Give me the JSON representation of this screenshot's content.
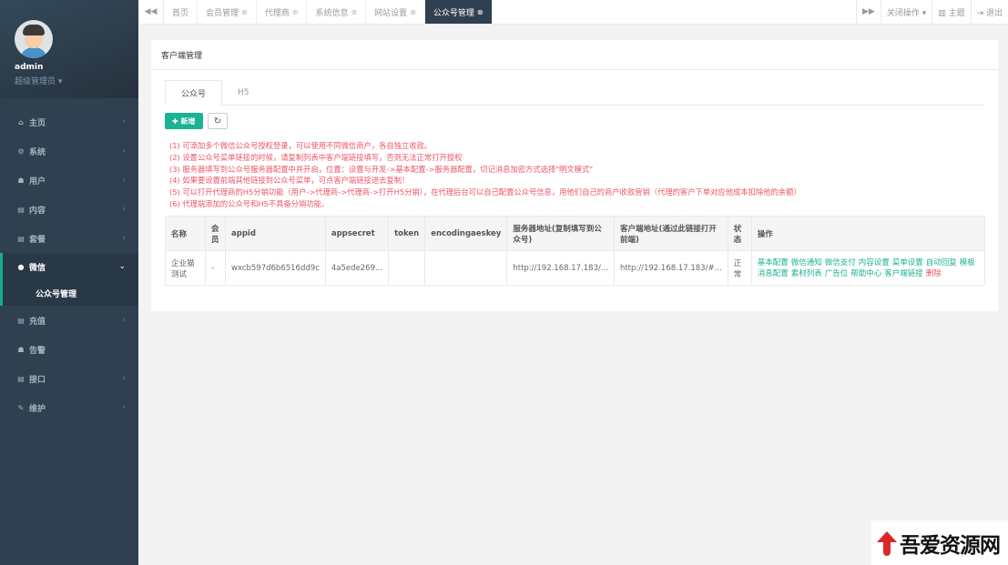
{
  "sidebar": {
    "user": {
      "name": "admin",
      "role": "超级管理员 ▾"
    },
    "items": [
      {
        "icon": "home-icon",
        "glyph": "⌂",
        "label": "主页",
        "arrow": "‹"
      },
      {
        "icon": "gears-icon",
        "glyph": "⚙",
        "label": "系统",
        "arrow": "‹"
      },
      {
        "icon": "users-icon",
        "glyph": "☗",
        "label": "用户",
        "arrow": "‹"
      },
      {
        "icon": "file-icon",
        "glyph": "▤",
        "label": "内容",
        "arrow": "‹"
      },
      {
        "icon": "file-text-icon",
        "glyph": "▤",
        "label": "套餐",
        "arrow": "‹"
      },
      {
        "icon": "wechat-icon",
        "glyph": "●",
        "label": "微信",
        "arrow": "⌄"
      },
      {
        "label": "公众号管理"
      },
      {
        "icon": "file-text-icon",
        "glyph": "▤",
        "label": "充值",
        "arrow": "‹"
      },
      {
        "icon": "users-icon",
        "glyph": "☗",
        "label": "告警",
        "arrow": ""
      },
      {
        "icon": "file-icon",
        "glyph": "▤",
        "label": "接口",
        "arrow": "‹"
      },
      {
        "icon": "wrench-icon",
        "glyph": "✎",
        "label": "维护",
        "arrow": "‹"
      }
    ]
  },
  "topbar": {
    "back_glyph": "◀◀",
    "forward_glyph": "▶▶",
    "tabs": [
      {
        "label": "首页",
        "close": ""
      },
      {
        "label": "会员管理",
        "close": "⊗"
      },
      {
        "label": "代理商",
        "close": "⊗"
      },
      {
        "label": "系统信息",
        "close": "⊗"
      },
      {
        "label": "网站设置",
        "close": "⊗"
      },
      {
        "label": "公众号管理",
        "close": "⊗"
      }
    ],
    "close_ops": "关闭操作 ▾",
    "theme": "▥ 主题",
    "logout": "⇥ 退出"
  },
  "panel": {
    "title": "客户端管理",
    "tabs": [
      "公众号",
      "H5"
    ],
    "add_label": "✚ 新增",
    "refresh_glyph": "↻",
    "notes": [
      "(1) 可添加多个微信公众号授权登录，可以使用不同微信商户，各自独立收款。",
      "(2) 设置公众号菜单链接的时候，请复制列表中客户端链接填写，否则无法正常打开授权",
      "(3) 服务器填写到公众号服务器配置中并开启，位置：设置与开发->基本配置->服务器配置，切记消息加密方式选择\"明文模式\"",
      "(4) 如果要设置前端其他链接到公众号菜单，可点客户端链接进去复制！",
      "(5) 可以打开代理商的H5分销功能（用户->代理商->代理商->打开H5分销），在代理后台可以自己配置公众号信息，用他们自己的商户收款营销（代理的客户下单对应他成本扣除他的余额）",
      "(6) 代理端添加的公众号和H5不具备分销功能。"
    ],
    "table": {
      "headers": [
        "名称",
        "会员",
        "appid",
        "appsecret",
        "token",
        "encodingaeskey",
        "服务器地址(复制填写到公众号)",
        "客户端地址(通过此链接打开前端)",
        "状态",
        "操作"
      ],
      "rows": [
        {
          "name": "企业猫测试",
          "member": "-",
          "appid": "wxcb597d6b6516dd9c",
          "appsecret": "4a5ede269...",
          "token": "",
          "encodingaeskey": "",
          "server": "http://192.168.17.183/...",
          "client": "http://192.168.17.183/#...",
          "status": "正常",
          "ops": [
            "基本配置",
            "微信通知",
            "微信支付",
            "内容设置",
            "菜单设置",
            "自动回复",
            "模板消息配置",
            "素材列表",
            "广告位",
            "帮助中心",
            "客户端链接",
            "删除"
          ]
        }
      ]
    }
  },
  "watermark": {
    "text": "吾爱资源网"
  }
}
